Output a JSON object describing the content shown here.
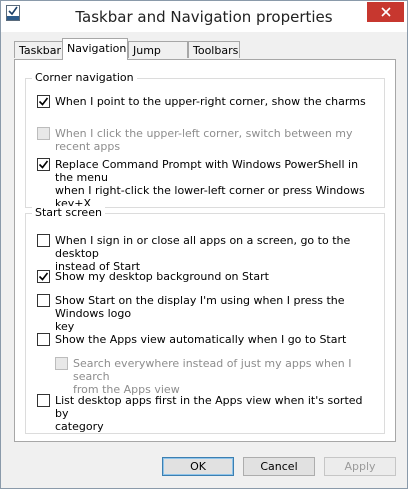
{
  "window": {
    "title": "Taskbar and Navigation properties"
  },
  "tabs": [
    {
      "label": "Taskbar",
      "active": false
    },
    {
      "label": "Navigation",
      "active": true
    },
    {
      "label": "Jump Lists",
      "active": false
    },
    {
      "label": "Toolbars",
      "active": false
    }
  ],
  "corner_navigation": {
    "title": "Corner navigation",
    "options": [
      {
        "label": "When I point to the upper-right corner, show the charms",
        "checked": true,
        "enabled": true
      },
      {
        "label": "When I click the upper-left corner, switch between my recent apps",
        "checked": false,
        "enabled": false
      },
      {
        "label_line1": "Replace Command Prompt with Windows PowerShell in the menu",
        "label_line2": "when I right-click the lower-left corner or press Windows key+X",
        "checked": true,
        "enabled": true
      }
    ]
  },
  "start_screen": {
    "title": "Start screen",
    "options": [
      {
        "label_line1": "When I sign in or close all apps on a screen, go to the desktop",
        "label_line2": "instead of Start",
        "checked": false,
        "enabled": true
      },
      {
        "label": "Show my desktop background on Start",
        "checked": true,
        "enabled": true
      },
      {
        "label_line1": "Show Start on the display I'm using when I press the Windows logo",
        "label_line2": "key",
        "checked": false,
        "enabled": true
      },
      {
        "label": "Show the Apps view automatically when I go to Start",
        "checked": false,
        "enabled": true
      },
      {
        "label_line1": "Search everywhere instead of just my apps when I search",
        "label_line2": "from the Apps view",
        "checked": false,
        "enabled": false
      },
      {
        "label_line1": "List desktop apps first in the Apps view when it's sorted by",
        "label_line2": "category",
        "checked": false,
        "enabled": true
      }
    ]
  },
  "buttons": {
    "ok": "OK",
    "cancel": "Cancel",
    "apply": "Apply"
  }
}
